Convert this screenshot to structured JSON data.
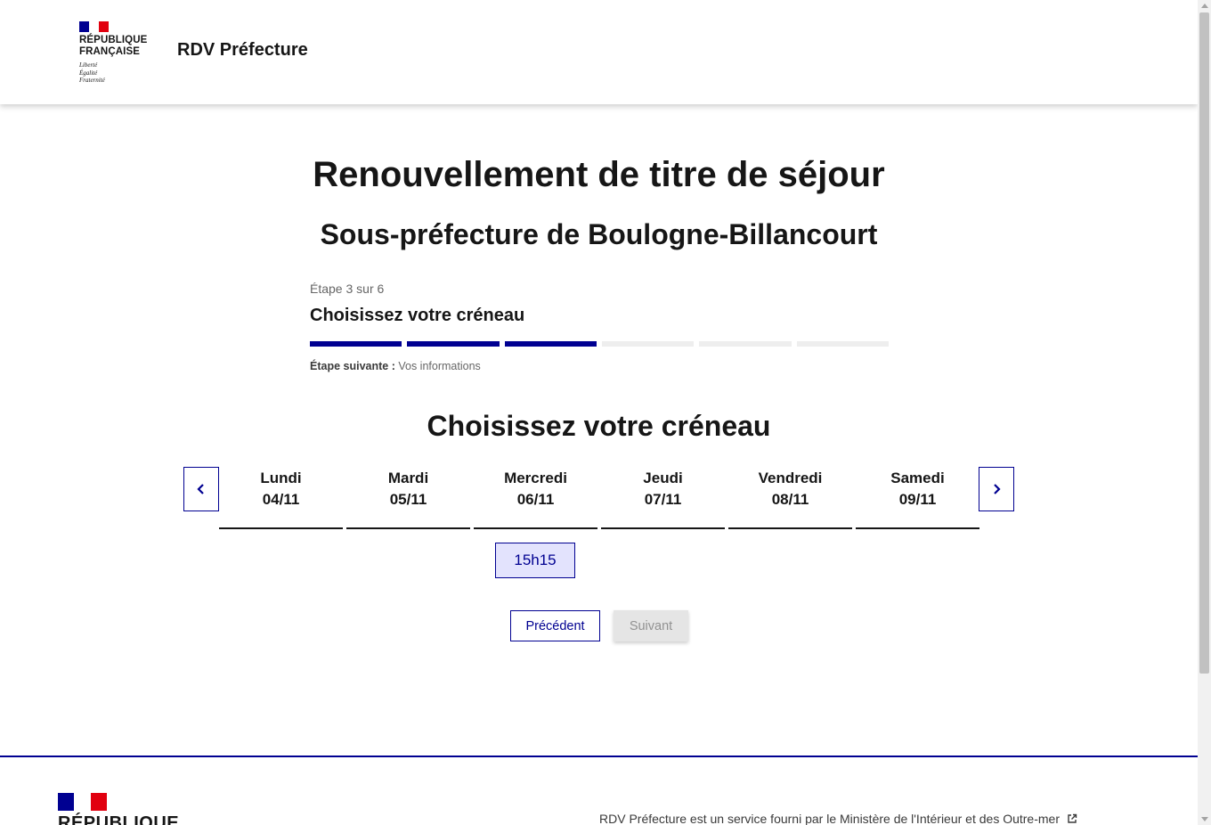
{
  "header": {
    "republique": [
      "RÉPUBLIQUE",
      "FRANÇAISE"
    ],
    "devise": [
      "Liberté",
      "Égalité",
      "Fraternité"
    ],
    "service_name": "RDV Préfecture"
  },
  "main": {
    "title": "Renouvellement de titre de séjour",
    "subtitle": "Sous-préfecture de Boulogne-Billancourt",
    "stepper": {
      "state": "Étape 3 sur 6",
      "title": "Choisissez votre créneau",
      "total_steps": 6,
      "current_step": 3,
      "next_label": "Étape suivante :",
      "next_value": "Vos informations"
    },
    "section_title": "Choisissez votre créneau",
    "days": [
      {
        "name": "Lundi",
        "date": "04/11"
      },
      {
        "name": "Mardi",
        "date": "05/11"
      },
      {
        "name": "Mercredi",
        "date": "06/11"
      },
      {
        "name": "Jeudi",
        "date": "07/11"
      },
      {
        "name": "Vendredi",
        "date": "08/11"
      },
      {
        "name": "Samedi",
        "date": "09/11"
      }
    ],
    "slots": [
      {
        "day": "Mercredi",
        "time": "15h15"
      }
    ],
    "buttons": {
      "previous": "Précédent",
      "next": "Suivant"
    }
  },
  "footer": {
    "republique": "RÉPUBLIQUE",
    "text": "RDV Préfecture est un service fourni par le Ministère de l'Intérieur et des Outre-mer"
  },
  "colors": {
    "primary": "#000091",
    "red": "#e1000f",
    "slot_bg": "#e3e3fd",
    "disabled_bg": "#e5e5e5"
  }
}
